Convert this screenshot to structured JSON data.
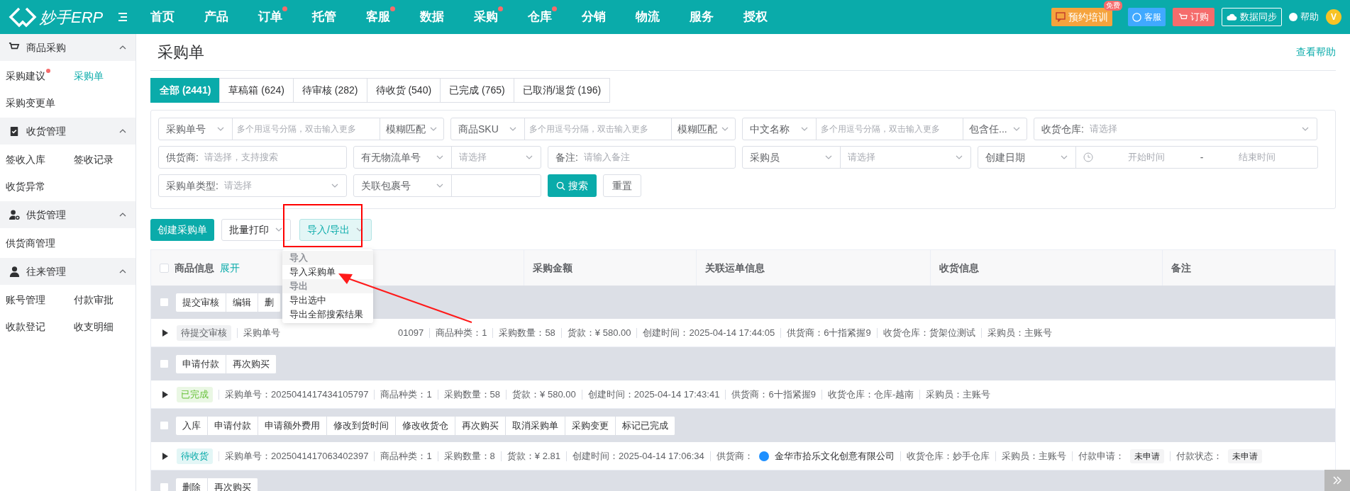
{
  "topbar": {
    "logo": "妙手ERP",
    "nav": [
      {
        "label": "首页",
        "badge": false
      },
      {
        "label": "产品",
        "badge": false
      },
      {
        "label": "订单",
        "badge": true
      },
      {
        "label": "托管",
        "badge": false
      },
      {
        "label": "客服",
        "badge": true
      },
      {
        "label": "数据",
        "badge": false
      },
      {
        "label": "采购",
        "badge": true
      },
      {
        "label": "仓库",
        "badge": true
      },
      {
        "label": "分销",
        "badge": false
      },
      {
        "label": "物流",
        "badge": false
      },
      {
        "label": "服务",
        "badge": false
      },
      {
        "label": "授权",
        "badge": false
      }
    ],
    "training": {
      "label": "预约培训",
      "tag": "免费"
    },
    "service": "客服",
    "order": "订购",
    "sync": "数据同步",
    "help": "帮助",
    "avatar": "V"
  },
  "sidebar": [
    {
      "title": "商品采购",
      "expanded": true,
      "items": [
        {
          "label": "采购建议",
          "badge": true,
          "selected": false
        },
        {
          "label": "采购单",
          "badge": false,
          "selected": true
        },
        {
          "label": "采购变更单",
          "badge": false,
          "selected": false
        }
      ]
    },
    {
      "title": "收货管理",
      "expanded": true,
      "items": [
        {
          "label": "签收入库",
          "badge": false,
          "selected": false
        },
        {
          "label": "签收记录",
          "badge": false,
          "selected": false
        },
        {
          "label": "收货异常",
          "badge": false,
          "selected": false
        }
      ]
    },
    {
      "title": "供货管理",
      "expanded": true,
      "items": [
        {
          "label": "供货商管理",
          "badge": false,
          "selected": false
        }
      ]
    },
    {
      "title": "往来管理",
      "expanded": true,
      "items": [
        {
          "label": "账号管理",
          "badge": false,
          "selected": false
        },
        {
          "label": "付款审批",
          "badge": false,
          "selected": false
        },
        {
          "label": "收款登记",
          "badge": false,
          "selected": false
        },
        {
          "label": "收支明细",
          "badge": false,
          "selected": false
        }
      ]
    }
  ],
  "page": {
    "title": "采购单",
    "help_link": "查看帮助"
  },
  "tabs": [
    {
      "label": "全部 (2441)",
      "selected": true
    },
    {
      "label": "草稿箱 (624)",
      "selected": false
    },
    {
      "label": "待审核 (282)",
      "selected": false
    },
    {
      "label": "待收货 (540)",
      "selected": false
    },
    {
      "label": "已完成 (765)",
      "selected": false
    },
    {
      "label": "已取消/退货 (196)",
      "selected": false
    }
  ],
  "filters": [
    [
      {
        "kind": "combo",
        "select": "采购单号",
        "placeholder": "多个用逗号分隔，双击输入更多",
        "match": "模糊匹配"
      },
      {
        "kind": "combo",
        "select": "商品SKU",
        "placeholder": "多个用逗号分隔，双击输入更多",
        "match": "模糊匹配"
      },
      {
        "kind": "combo",
        "select": "中文名称",
        "placeholder": "多个用逗号分隔，双击输入更多",
        "match": "包含任..."
      },
      {
        "kind": "labeled",
        "label": "收货仓库:",
        "placeholder": "请选择",
        "caret": true
      }
    ],
    [
      {
        "kind": "labeled",
        "label": "供货商:",
        "placeholder": "请选择，支持搜索",
        "caret": false
      },
      {
        "kind": "pair",
        "select": "有无物流单号",
        "placeholder": "请选择"
      },
      {
        "kind": "labeled",
        "label": "备注:",
        "placeholder": "请输入备注",
        "caret": false
      },
      {
        "kind": "pair",
        "select": "采购员",
        "placeholder": "请选择"
      },
      {
        "kind": "date",
        "select": "创建日期",
        "start": "开始时间",
        "separator": "-",
        "end": "结束时间"
      }
    ],
    [
      {
        "kind": "labeled",
        "label": "采购单类型:",
        "placeholder": "请选择",
        "caret": true
      },
      {
        "kind": "pair",
        "select": "关联包裹号"
      },
      {
        "kind": "search",
        "label": "搜索"
      },
      {
        "kind": "reset",
        "label": "重置"
      }
    ]
  ],
  "toolbar": {
    "create": "创建采购单",
    "print": "批量打印",
    "import_export": "导入/导出"
  },
  "menu": [
    {
      "label": "导入",
      "kind": "group"
    },
    {
      "label": "导入采购单",
      "kind": "item"
    },
    {
      "label": "导出",
      "kind": "group"
    },
    {
      "label": "导出选中",
      "kind": "item"
    },
    {
      "label": "导出全部搜索结果",
      "kind": "item"
    }
  ],
  "table": {
    "columns": [
      "商品信息",
      "采购金额",
      "关联运单信息",
      "收货信息",
      "备注"
    ],
    "expand": "展开",
    "checked": false
  },
  "orders": [
    {
      "checked": false,
      "actions": [
        "提交审核",
        "编辑",
        "删"
      ],
      "status": {
        "text": "待提交审核",
        "kind": "draft"
      },
      "fields": [
        {
          "label": "采购单号",
          "value": "01097",
          "kind": "hidden"
        },
        {
          "label": "商品种类：",
          "value": "1",
          "kind": "text"
        },
        {
          "label": "采购数量：",
          "value": "58",
          "kind": "text"
        },
        {
          "label": "货款：",
          "value": "¥ 580.00",
          "kind": "text"
        },
        {
          "label": "创建时间：",
          "value": "2025-04-14 17:44:05",
          "kind": "text"
        },
        {
          "label": "供货商：",
          "value": "6十指紧握9",
          "kind": "text"
        },
        {
          "label": "收货仓库：",
          "value": "货架位测试",
          "kind": "text"
        },
        {
          "label": "采购员：",
          "value": "主账号",
          "kind": "text"
        }
      ]
    },
    {
      "checked": false,
      "actions": [
        "申请付款",
        "再次购买"
      ],
      "status": {
        "text": "已完成",
        "kind": "done"
      },
      "fields": [
        {
          "label": "采购单号：",
          "value": "2025041417434105797",
          "kind": "text"
        },
        {
          "label": "商品种类：",
          "value": "1",
          "kind": "text"
        },
        {
          "label": "采购数量：",
          "value": "58",
          "kind": "text"
        },
        {
          "label": "货款：",
          "value": "¥ 580.00",
          "kind": "text"
        },
        {
          "label": "创建时间：",
          "value": "2025-04-14 17:43:41",
          "kind": "text"
        },
        {
          "label": "供货商：",
          "value": "6十指紧握9",
          "kind": "text"
        },
        {
          "label": "收货仓库：",
          "value": "仓库-越南",
          "kind": "text"
        },
        {
          "label": "采购员：",
          "value": "主账号",
          "kind": "text"
        }
      ]
    },
    {
      "checked": false,
      "actions": [
        "入库",
        "申请付款",
        "申请额外费用",
        "修改到货时间",
        "修改收货仓",
        "再次购买",
        "取消采购单",
        "采购变更",
        "标记已完成"
      ],
      "status": {
        "text": "待收货",
        "kind": "receiving"
      },
      "fields": [
        {
          "label": "采购单号：",
          "value": "2025041417063402397",
          "kind": "text"
        },
        {
          "label": "商品种类：",
          "value": "1",
          "kind": "text"
        },
        {
          "label": "采购数量：",
          "value": "8",
          "kind": "text"
        },
        {
          "label": "货款：",
          "value": "¥ 2.81",
          "kind": "text"
        },
        {
          "label": "创建时间：",
          "value": "2025-04-14 17:06:34",
          "kind": "text"
        },
        {
          "label": "供货商：",
          "value": "金华市拾乐文化创意有限公司",
          "kind": "icon"
        },
        {
          "label": "收货仓库：",
          "value": "妙手仓库",
          "kind": "text"
        },
        {
          "label": "采购员：",
          "value": "主账号",
          "kind": "text"
        },
        {
          "label": "付款申请：",
          "value": "未申请",
          "kind": "tag"
        },
        {
          "label": "付款状态：",
          "value": "未申请",
          "kind": "tag"
        }
      ]
    },
    {
      "checked": false,
      "actions": [
        "删除",
        "再次购买"
      ]
    }
  ]
}
